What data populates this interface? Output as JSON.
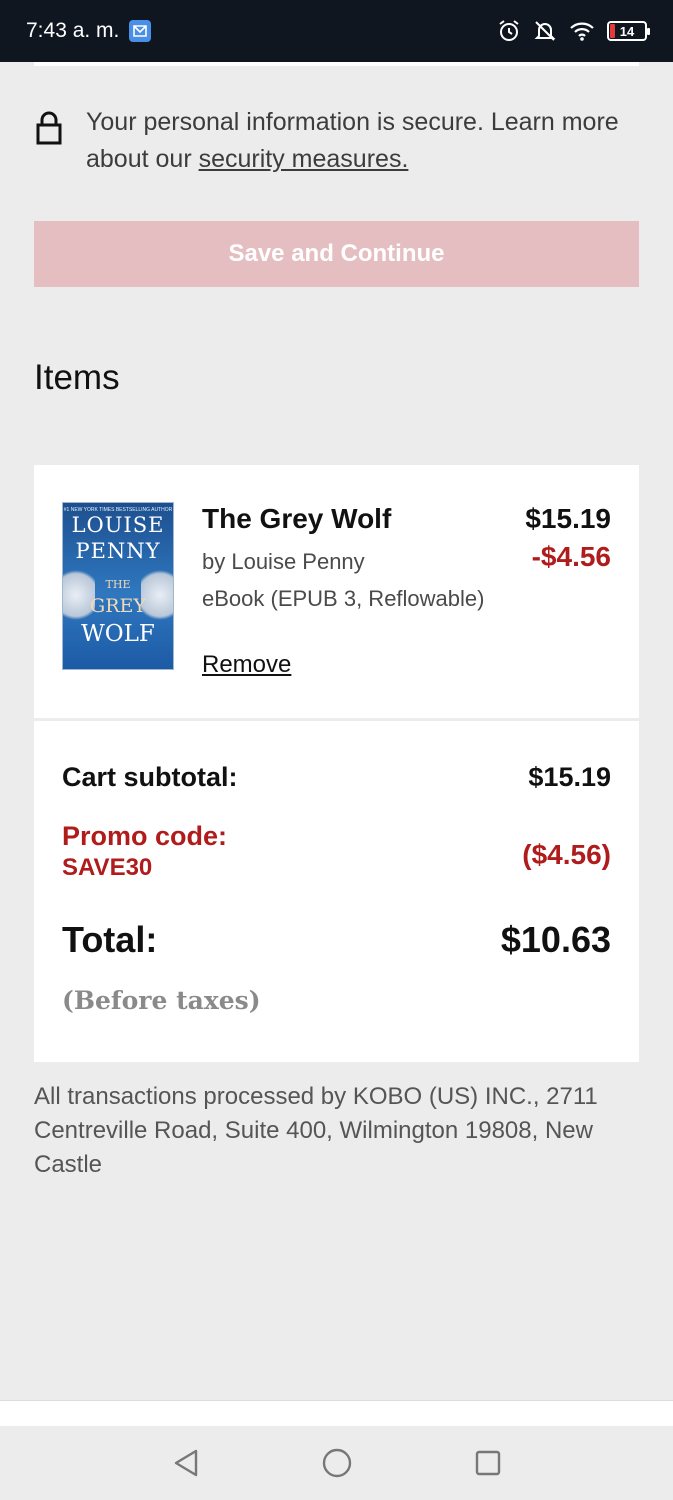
{
  "status_bar": {
    "time": "7:43 a. m.",
    "battery": "14",
    "icons": [
      "mail-app-icon",
      "alarm-icon",
      "notifications-off-icon",
      "wifi-icon",
      "battery-icon"
    ]
  },
  "security": {
    "text": "Your personal information is secure. Learn more about our ",
    "link": "security measures."
  },
  "save_button": {
    "label": "Save and Continue"
  },
  "items": {
    "heading": "Items",
    "list": [
      {
        "cover": {
          "tagline": "#1 NEW YORK TIMES BESTSELLING AUTHOR",
          "author_line1": "LOUISE",
          "author_line2": "PENNY",
          "title_the": "THE",
          "title_grey": "GREY",
          "title_wolf": "WOLF"
        },
        "title": "The Grey Wolf",
        "author": "by Louise Penny",
        "format": "eBook (EPUB 3, Reflowable)",
        "remove_label": "Remove",
        "price": "$15.19",
        "discount": "-$4.56"
      }
    ]
  },
  "totals": {
    "subtotal_label": "Cart subtotal:",
    "subtotal_value": "$15.19",
    "promo_label": "Promo code:",
    "promo_code": "SAVE30",
    "promo_value": "($4.56)",
    "total_label": "Total:",
    "total_value": "$10.63",
    "before_taxes": "(Before taxes)"
  },
  "footer": {
    "transactions": "All transactions processed by KOBO (US) INC., 2711 Centreville Road, Suite 400, Wilmington 19808, New Castle"
  },
  "colors": {
    "accent_red": "#b01c1c",
    "disabled_button": "#e5bec1",
    "status_bar": "#0f1620",
    "background": "#ececec"
  }
}
